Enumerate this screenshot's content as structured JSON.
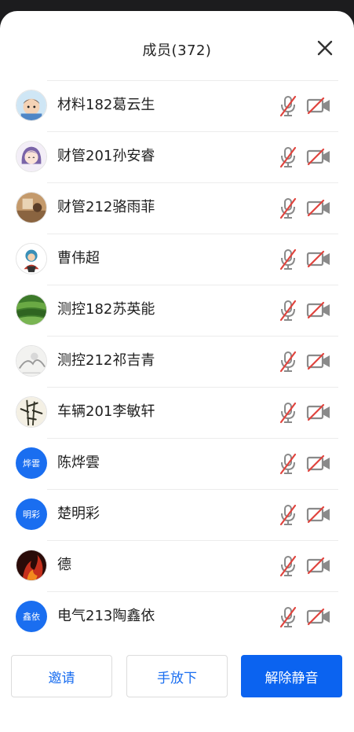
{
  "header": {
    "title": "成员(372)"
  },
  "members": [
    {
      "name": "材料182葛云生",
      "avatar_kind": "illustration-boy-icon",
      "avatar_text": ""
    },
    {
      "name": "财管201孙安睿",
      "avatar_kind": "illustration-girl-icon",
      "avatar_text": ""
    },
    {
      "name": "财管212骆雨菲",
      "avatar_kind": "photo-interior-icon",
      "avatar_text": ""
    },
    {
      "name": "曹伟超",
      "avatar_kind": "illustration-cartoon-icon",
      "avatar_text": ""
    },
    {
      "name": "测控182苏英能",
      "avatar_kind": "photo-landscape-icon",
      "avatar_text": ""
    },
    {
      "name": "测控212祁吉青",
      "avatar_kind": "ink-painting-icon",
      "avatar_text": ""
    },
    {
      "name": "车辆201李敏轩",
      "avatar_kind": "bamboo-painting-icon",
      "avatar_text": ""
    },
    {
      "name": "陈烨雲",
      "avatar_kind": "initials",
      "avatar_text": "烨雲"
    },
    {
      "name": "楚明彩",
      "avatar_kind": "initials",
      "avatar_text": "明彩"
    },
    {
      "name": "德",
      "avatar_kind": "photo-fire-icon",
      "avatar_text": ""
    },
    {
      "name": "电气213陶鑫依",
      "avatar_kind": "initials",
      "avatar_text": "鑫依"
    }
  ],
  "status_icons": {
    "mic": "mic-muted-icon",
    "camera": "camera-off-icon"
  },
  "footer": {
    "invite_label": "邀请",
    "hand_down_label": "手放下",
    "unmute_label": "解除静音"
  },
  "colors": {
    "accent": "#0b63f0",
    "avatar_blue": "#1a6ef0",
    "muted_red": "#e0443e",
    "icon_gray": "#8a8a8a"
  }
}
